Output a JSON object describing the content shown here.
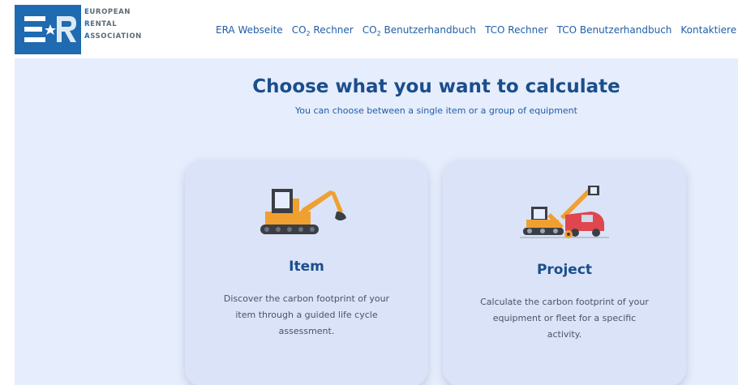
{
  "logo": {
    "mark_color": "#1f6ab1",
    "lines": [
      {
        "first": "E",
        "rest": "UROPEAN"
      },
      {
        "first": "R",
        "rest": "ENTAL"
      },
      {
        "first": "A",
        "rest": "SSOCIATION"
      }
    ]
  },
  "nav": {
    "items": [
      {
        "label": "ERA Webseite"
      },
      {
        "pre": "CO",
        "sub": "2",
        "post": " Rechner"
      },
      {
        "pre": "CO",
        "sub": "2",
        "post": " Benutzerhandbuch"
      },
      {
        "label": "TCO Rechner"
      },
      {
        "label": "TCO Benutzerhandbuch"
      },
      {
        "label": "Kontaktiere uns"
      }
    ]
  },
  "hero": {
    "title": "Choose what you want to calculate",
    "subtitle": "You can choose between a single item or a group of equipment"
  },
  "cards": {
    "item": {
      "title": "Item",
      "description": "Discover the carbon footprint of your item through a guided life cycle assessment.",
      "icon": "excavator-icon"
    },
    "project": {
      "title": "Project",
      "description": "Calculate the carbon footprint of your equipment or fleet for a specific activity.",
      "icon": "machinery-fleet-icon"
    }
  },
  "colors": {
    "brand": "#1f6ab1",
    "background": "#e6edfc",
    "card": "#dae3f7",
    "heading": "#1a4e8c"
  }
}
